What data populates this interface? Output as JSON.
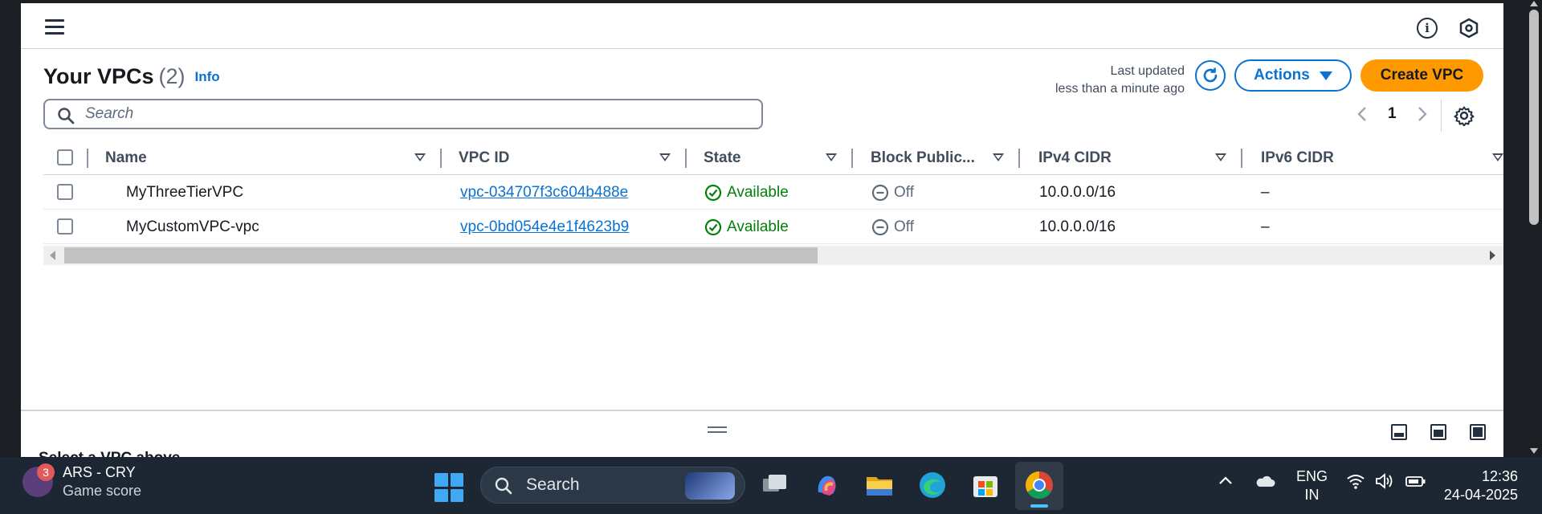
{
  "header": {
    "menu_icon": "hamburger-icon",
    "info_icon": "info-icon",
    "extra_icon": "settings-hex-icon"
  },
  "page": {
    "title": "Your VPCs",
    "count": "(2)",
    "info_link": "Info",
    "last_updated_label": "Last updated",
    "last_updated_value": "less than a minute ago",
    "actions_label": "Actions",
    "create_label": "Create VPC",
    "search_placeholder": "Search",
    "current_page": "1"
  },
  "table": {
    "columns": [
      "Name",
      "VPC ID",
      "State",
      "Block Public...",
      "IPv4 CIDR",
      "IPv6 CIDR"
    ],
    "rows": [
      {
        "name": "MyThreeTierVPC",
        "vpc_id": "vpc-034707f3c604b488e",
        "state": "Available",
        "block_public": "Off",
        "ipv4": "10.0.0.0/16",
        "ipv6": "–"
      },
      {
        "name": "MyCustomVPC-vpc",
        "vpc_id": "vpc-0bd054e4e1f4623b9",
        "state": "Available",
        "block_public": "Off",
        "ipv4": "10.0.0.0/16",
        "ipv6": "–"
      }
    ]
  },
  "detail_panel": {
    "message": "Select a VPC above"
  },
  "taskbar": {
    "widget_badge": "3",
    "widget_title": "ARS - CRY",
    "widget_subtitle": "Game score",
    "search_label": "Search",
    "lang_line1": "ENG",
    "lang_line2": "IN",
    "time": "12:36",
    "date": "24-04-2025"
  },
  "colors": {
    "accent": "#0972d3",
    "primary_button": "#ff9900",
    "success": "#037f0c",
    "taskbar": "#1c2733"
  }
}
